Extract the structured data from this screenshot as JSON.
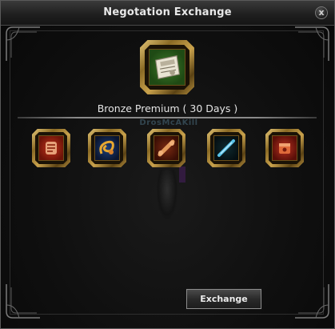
{
  "window": {
    "title": "Negotation Exchange",
    "close_label": "x"
  },
  "reward": {
    "name": "Bronze Premium ( 30 Days )",
    "icon": "premium-ticket-icon"
  },
  "required_items": [
    {
      "icon": "red-scroll-icon"
    },
    {
      "icon": "golden-rune-icon"
    },
    {
      "icon": "orange-bone-icon"
    },
    {
      "icon": "blue-blade-icon"
    },
    {
      "icon": "red-box-icon"
    }
  ],
  "background_character": {
    "name": "DrosMcAKill"
  },
  "actions": {
    "exchange_label": "Exchange"
  },
  "colors": {
    "gold_frame": "#c9a24c",
    "title_text": "#e8e8e8",
    "panel_bg": "#0f0f0f"
  }
}
